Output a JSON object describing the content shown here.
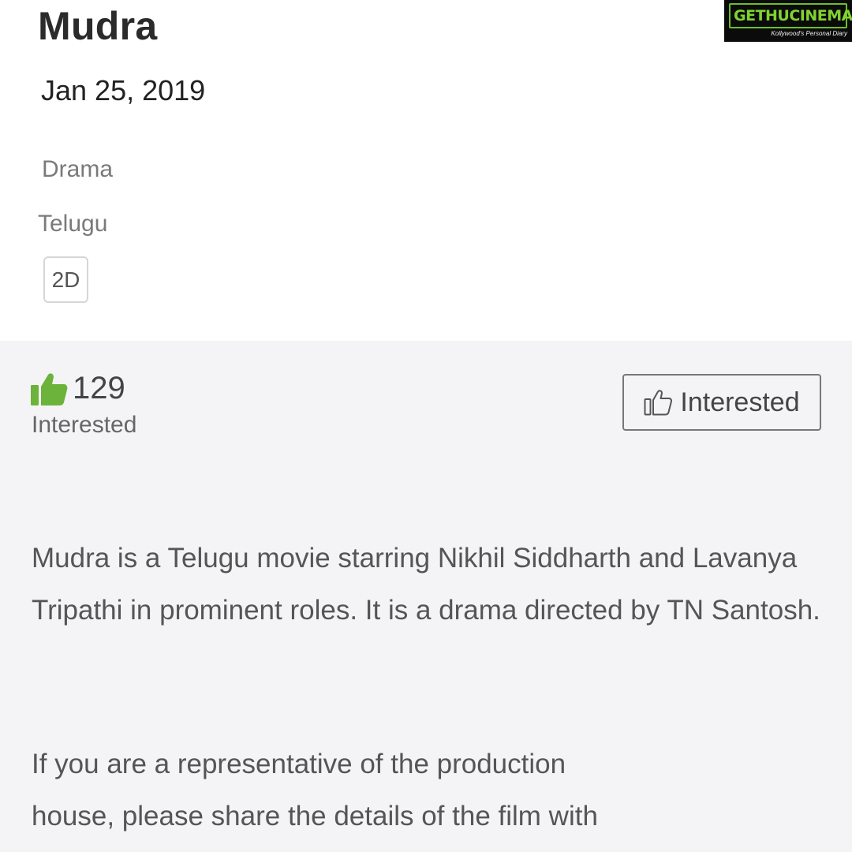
{
  "movie": {
    "title": "Mudra",
    "release_date": "Jan 25, 2019",
    "genre": "Drama",
    "language": "Telugu",
    "format": "2D"
  },
  "brand": {
    "logo_text": "GETHUCINEMA",
    "tagline": "Kollywood's Personal Diary"
  },
  "interest": {
    "count": "129",
    "count_label": "Interested",
    "button_label": "Interested",
    "accent_color": "#6bb33a"
  },
  "description": {
    "paragraph1": "Mudra is a Telugu movie starring Nikhil Siddharth and Lavanya Tripathi in prominent roles. It is a drama directed by TN Santosh.",
    "paragraph2": "If you are a representative of the production house, please share the details of the film with"
  },
  "icons": {
    "filled_thumb": "thumbs-up-filled-icon",
    "outline_thumb": "thumbs-up-outline-icon"
  }
}
